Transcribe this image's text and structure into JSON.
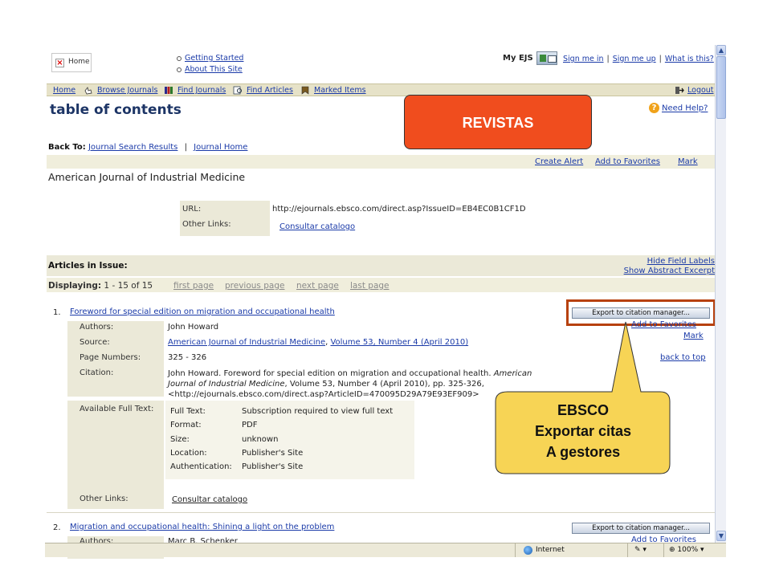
{
  "header": {
    "home_tab": "Home",
    "links": [
      "Getting Started",
      "About This Site"
    ],
    "my_ejs": "My EJS",
    "top_links": [
      "Sign me in",
      "Sign me up",
      "What is this?"
    ]
  },
  "navbar": {
    "items": [
      "Home",
      "Browse Journals",
      "Find Journals",
      "Find Articles",
      "Marked Items"
    ],
    "logout": "Logout"
  },
  "page": {
    "title": "table of contents",
    "need_help": "Need Help?",
    "back_to_label": "Back To:",
    "back_links": [
      "Journal Search Results",
      "Journal Home"
    ],
    "actions": [
      "Create Alert",
      "Add to Favorites",
      "Mark"
    ],
    "journal": "American Journal of Industrial Medicine",
    "url_label": "URL:",
    "url_value": "http://ejournals.ebsco.com/direct.asp?IssueID=EB4EC0B1CF1D",
    "other_links_label": "Other Links:",
    "catalog_link": "Consultar catalogo"
  },
  "articles": {
    "heading": "Articles in Issue:",
    "hide_labels": "Hide Field Labels",
    "show_abstract": "Show Abstract Excerpt",
    "displaying_label": "Displaying:",
    "displaying_range": "1 - 15 of 15",
    "paging": [
      "first page",
      "previous page",
      "next page",
      "last page"
    ],
    "export_label": "Export to citation manager...",
    "list": [
      {
        "num": "1.",
        "title": "Foreword for special edition on migration and occupational health",
        "authors_label": "Authors:",
        "authors": "John Howard",
        "source_label": "Source:",
        "source_journal": "American Journal of Industrial Medicine",
        "source_issue": "Volume 53, Number 4 (April 2010)",
        "pages_label": "Page Numbers:",
        "pages": "325 - 326",
        "citation_label": "Citation:",
        "citation_line1": "John Howard. Foreword for special edition on migration and occupational health.",
        "citation_journal": "American",
        "citation_line2_italic": "Journal of Industrial Medicine",
        "citation_line2": ", Volume 53, Number 4 (April 2010), pp. 325-326,",
        "citation_line3": "<http://ejournals.ebsco.com/direct.asp?ArticleID=470095D29A79E93EF909>",
        "fulltext_label": "Available Full Text:",
        "fulltext_rows": [
          {
            "k": "Full Text:",
            "v": "Subscription required to view full text"
          },
          {
            "k": "Format:",
            "v": "PDF"
          },
          {
            "k": "Size:",
            "v": "unknown"
          },
          {
            "k": "Location:",
            "v": "Publisher's Site"
          },
          {
            "k": "Authentication:",
            "v": "Publisher's Site"
          }
        ],
        "other_links_label": "Other Links:",
        "catalog_link": "Consultar catalogo",
        "add_fav": "Add to Favorites",
        "mark": "Mark",
        "back_to_top": "back to top"
      },
      {
        "num": "2.",
        "title": "Migration and occupational health: Shining a light on the problem",
        "authors_label": "Authors:",
        "authors": "Marc B. Schenker",
        "add_fav": "Add to Favorites"
      }
    ]
  },
  "statusbar": {
    "zone": "Internet",
    "zoom": "100%"
  },
  "callouts": {
    "revistas": "REVISTAS",
    "ebsco_lines": [
      "EBSCO",
      "Exportar citas",
      "A gestores"
    ],
    "revistas_color": "#f04d1e",
    "ebsco_color": "#f7d455",
    "frame_color": "#b7410e"
  }
}
